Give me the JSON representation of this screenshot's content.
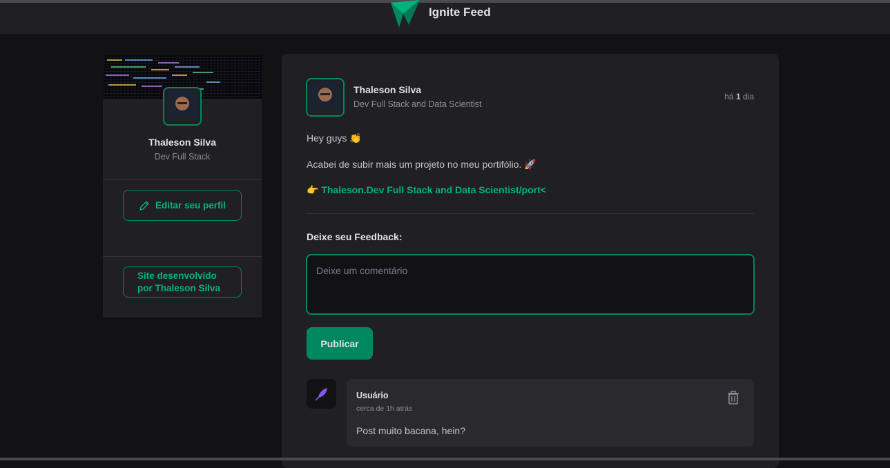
{
  "header": {
    "brand": "Ignite Feed",
    "logo_icon": "ignite-logo-icon",
    "accent": "#00875f"
  },
  "sidebar": {
    "name": "Thaleson Silva",
    "role": "Dev Full Stack",
    "edit_profile_label": "Editar seu perfil",
    "edit_icon": "pencil-icon",
    "credit_line1": "Site desenvolvido",
    "credit_line2": "por Thaleson Silva"
  },
  "post": {
    "author": "Thaleson Silva",
    "role": "Dev Full Stack and Data Scientist",
    "time_prefix": "há",
    "time_value": "1",
    "time_unit": "dia",
    "greeting": "Hey guys 👏",
    "text": "Acabei de subir mais um projeto no meu portifólio. 🚀",
    "link": "👉 Thaleson.Dev Full Stack and Data Scientist/port<",
    "feedback_title": "Deixe seu Feedback:",
    "comment_placeholder": "Deixe um comentário",
    "publish_label": "Publicar"
  },
  "comment": {
    "user": "Usuário",
    "time": "cerca de 1h atrás",
    "text": "Post muito bacana, hein?",
    "avatar_icon": "feather-icon",
    "delete_icon": "trash-icon"
  }
}
